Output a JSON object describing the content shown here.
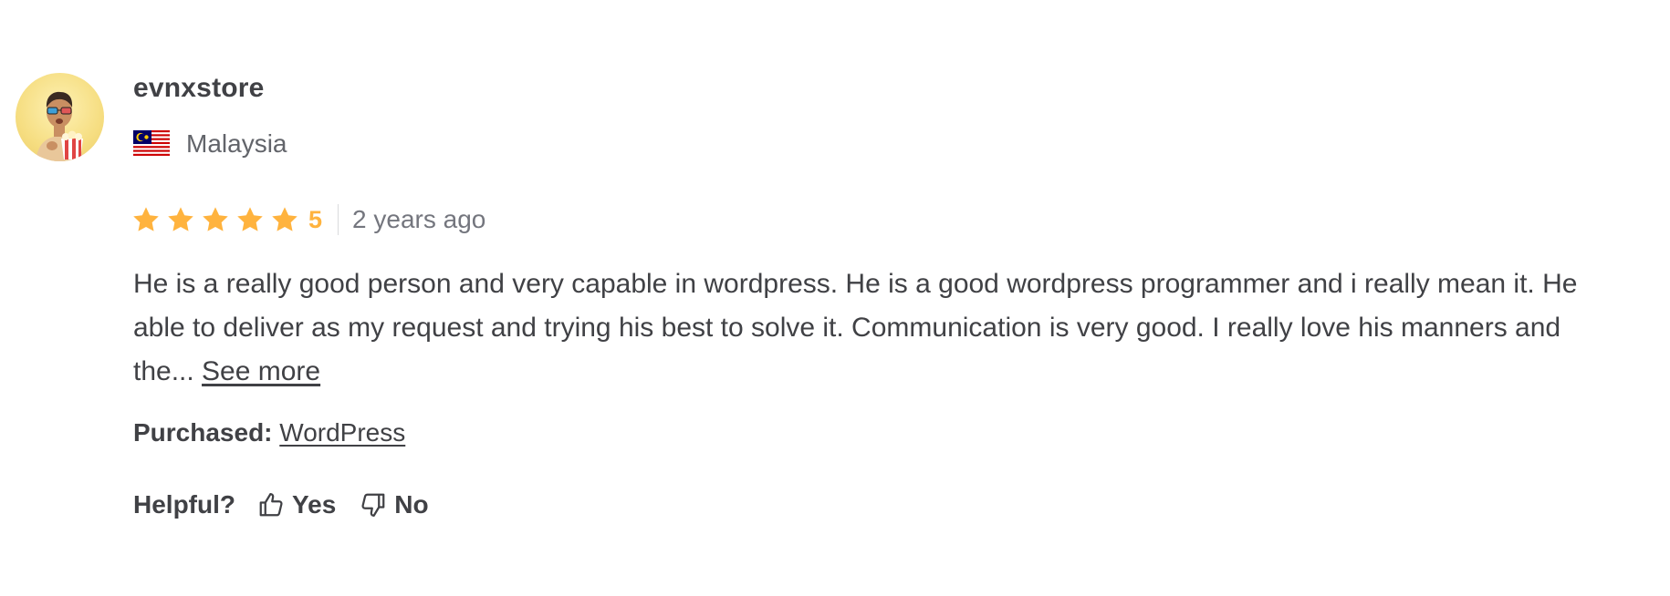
{
  "reviewer": {
    "username": "evnxstore",
    "country": "Malaysia",
    "avatar_icon": "user-avatar-popcorn",
    "flag_icon": "malaysia-flag-icon"
  },
  "rating": {
    "stars": 5,
    "score_label": "5",
    "time_ago": "2 years ago",
    "star_color": "#ffb33e"
  },
  "review": {
    "text": "He is a really good person and very capable in wordpress. He is a good wordpress programmer and i really mean it. He able to deliver as my request and trying his best to solve it. Communication is very good. I really love his manners and the... ",
    "see_more_label": "See more"
  },
  "purchased": {
    "label": "Purchased:",
    "item": "WordPress"
  },
  "helpful": {
    "label": "Helpful?",
    "yes_label": "Yes",
    "no_label": "No"
  }
}
